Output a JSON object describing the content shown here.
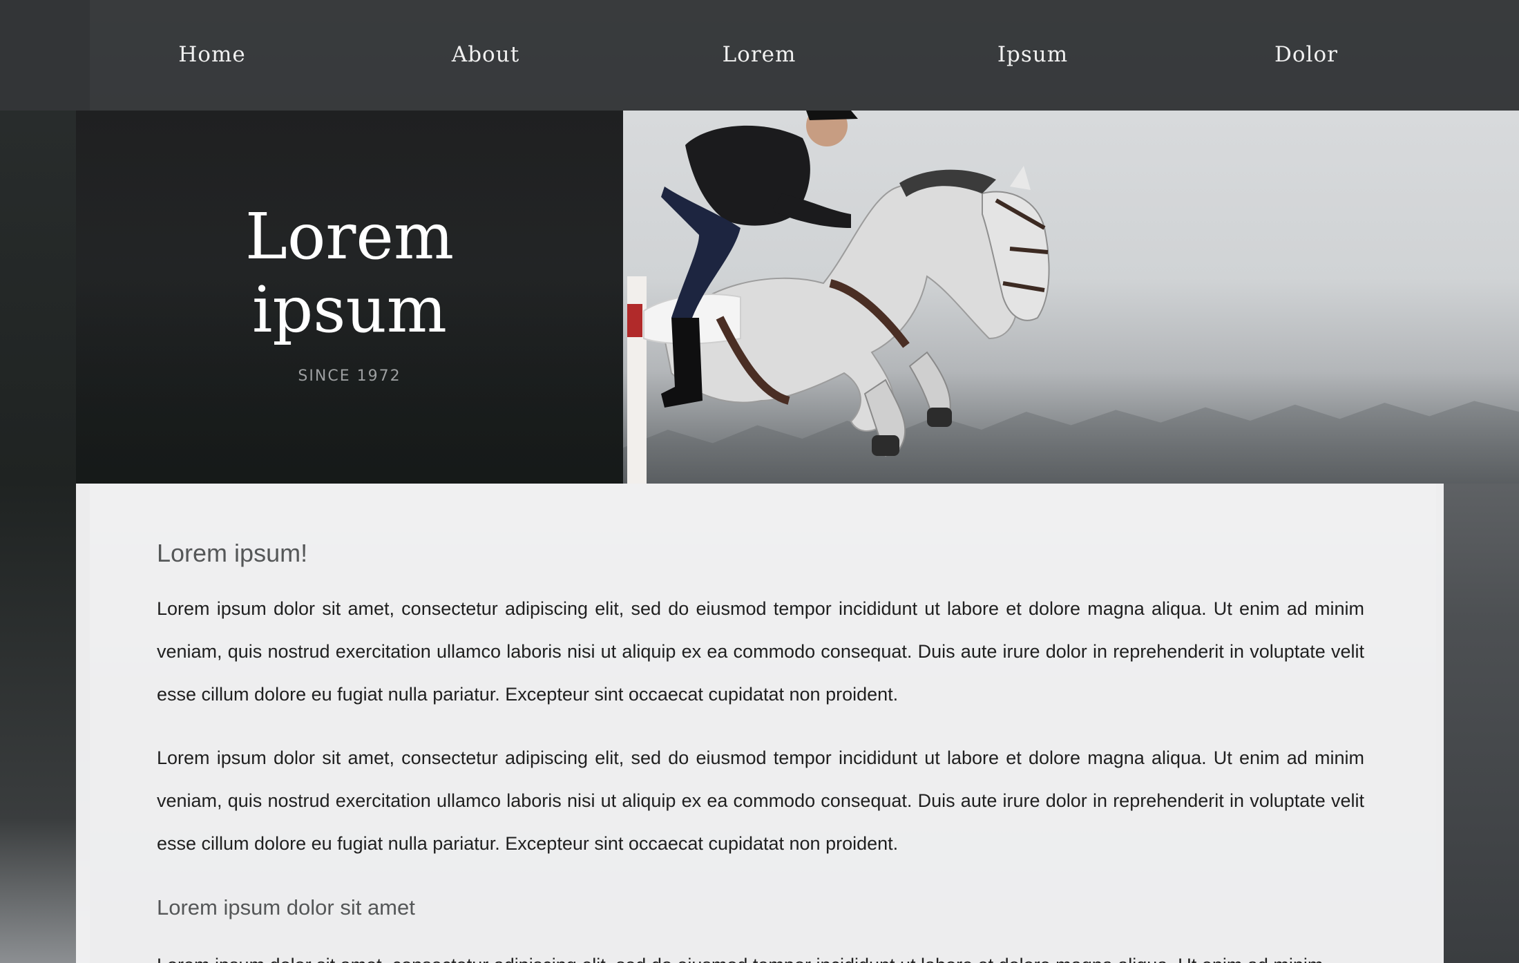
{
  "nav": {
    "items": [
      {
        "label": "Home"
      },
      {
        "label": "About"
      },
      {
        "label": "Lorem"
      },
      {
        "label": "Ipsum"
      },
      {
        "label": "Dolor"
      }
    ]
  },
  "hero": {
    "title_line1": "Lorem",
    "title_line2": "ipsum",
    "subtitle": "SINCE 1972"
  },
  "content": {
    "heading": "Lorem ipsum!",
    "paragraph1": "Lorem ipsum dolor sit amet, consectetur adipiscing elit, sed do eiusmod tempor incididunt ut labore et dolore magna aliqua. Ut enim ad minim veniam, quis nostrud exercitation ullamco laboris nisi ut aliquip ex ea commodo consequat. Duis aute irure dolor in reprehenderit in voluptate velit esse cillum dolore eu fugiat nulla pariatur. Excepteur sint occaecat cupidatat non proident.",
    "paragraph2": "Lorem ipsum dolor sit amet, consectetur adipiscing elit, sed do eiusmod tempor incididunt ut labore et dolore magna aliqua. Ut enim ad minim veniam, quis nostrud exercitation ullamco laboris nisi ut aliquip ex ea commodo consequat. Duis aute irure dolor in reprehenderit in voluptate velit esse cillum dolore eu fugiat nulla pariatur. Excepteur sint occaecat cupidatat non proident.",
    "subheading": "Lorem ipsum dolor sit amet",
    "paragraph3": "Lorem ipsum dolor sit amet, consectetur adipiscing elit, sed do eiusmod tempor incididunt ut labore et dolore magna aliqua. Ut enim ad minim"
  },
  "colors": {
    "nav_bg": "#343638",
    "hero_panel_bg": "#212223",
    "card_bg": "#f3f3f4",
    "heading_text": "#555758",
    "body_text": "#1f1f1f"
  }
}
